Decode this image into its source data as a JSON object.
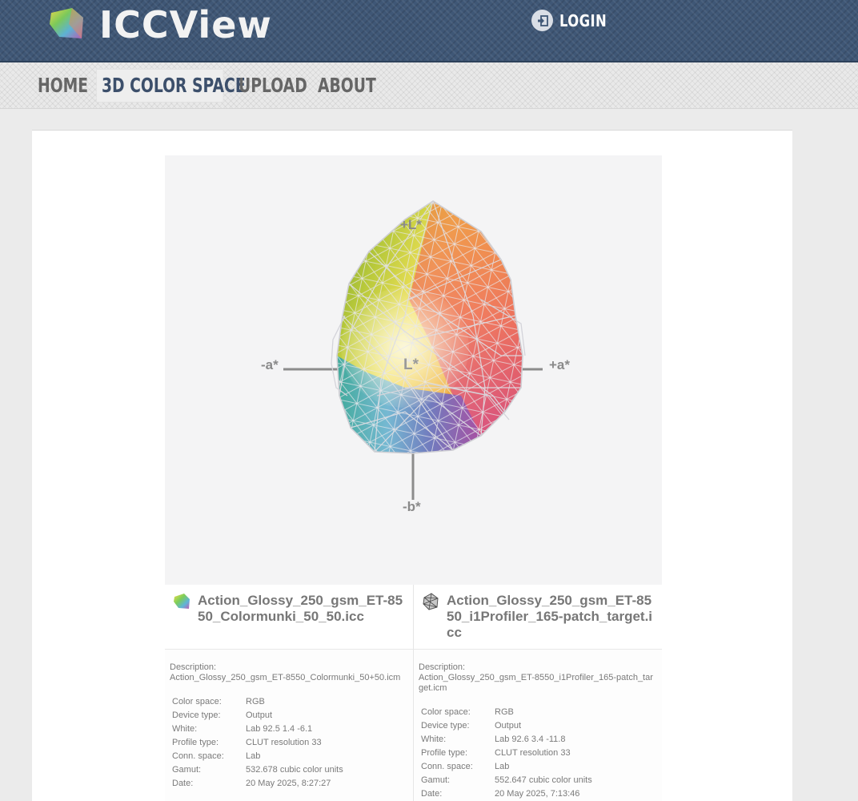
{
  "header": {
    "app_name": "ICCView",
    "login_label": "LOGIN",
    "logo_icon": "gamut-cube-logo",
    "login_icon": "sign-in-icon"
  },
  "nav": {
    "items": [
      {
        "label": "HOME",
        "active": false
      },
      {
        "label": "3D COLOR SPACE",
        "active": true
      },
      {
        "label": "UPLOAD",
        "active": false
      },
      {
        "label": "ABOUT",
        "active": false
      }
    ]
  },
  "viewer": {
    "axis_labels": {
      "plus_l": "+L*",
      "minus_a": "-a*",
      "plus_a": "+a*",
      "center": "L*",
      "minus_b": "-b*"
    }
  },
  "profiles": [
    {
      "title": "Action_Glossy_250_gsm_ET-8550_Colormunki_50_50.icc",
      "icon": "solid-gamut-icon",
      "description_label": "Description:",
      "description": "Action_Glossy_250_gsm_ET-8550_Colormunki_50+50.icm",
      "rows": [
        {
          "key": "Color space:",
          "value": "RGB"
        },
        {
          "key": "Device type:",
          "value": "Output"
        },
        {
          "key": "White:",
          "value": "Lab 92.5 1.4 -6.1"
        },
        {
          "key": "Profile type:",
          "value": "CLUT resolution 33"
        },
        {
          "key": "Conn. space:",
          "value": "Lab"
        },
        {
          "key": "Gamut:",
          "value": "532.678 cubic color units"
        },
        {
          "key": "Date:",
          "value": "20 May 2025, 8:27:27"
        }
      ]
    },
    {
      "title": "Action_Glossy_250_gsm_ET-8550_i1Profiler_165-patch_target.icc",
      "icon": "wireframe-gamut-icon",
      "description_label": "Description:",
      "description": "Action_Glossy_250_gsm_ET-8550_i1Profiler_165-patch_target.icm",
      "rows": [
        {
          "key": "Color space:",
          "value": "RGB"
        },
        {
          "key": "Device type:",
          "value": "Output"
        },
        {
          "key": "White:",
          "value": "Lab 92.6 3.4 -11.8"
        },
        {
          "key": "Profile type:",
          "value": "CLUT resolution 33"
        },
        {
          "key": "Conn. space:",
          "value": "Lab"
        },
        {
          "key": "Gamut:",
          "value": "552.647 cubic color units"
        },
        {
          "key": "Date:",
          "value": "20 May 2025, 7:13:46"
        }
      ]
    }
  ]
}
